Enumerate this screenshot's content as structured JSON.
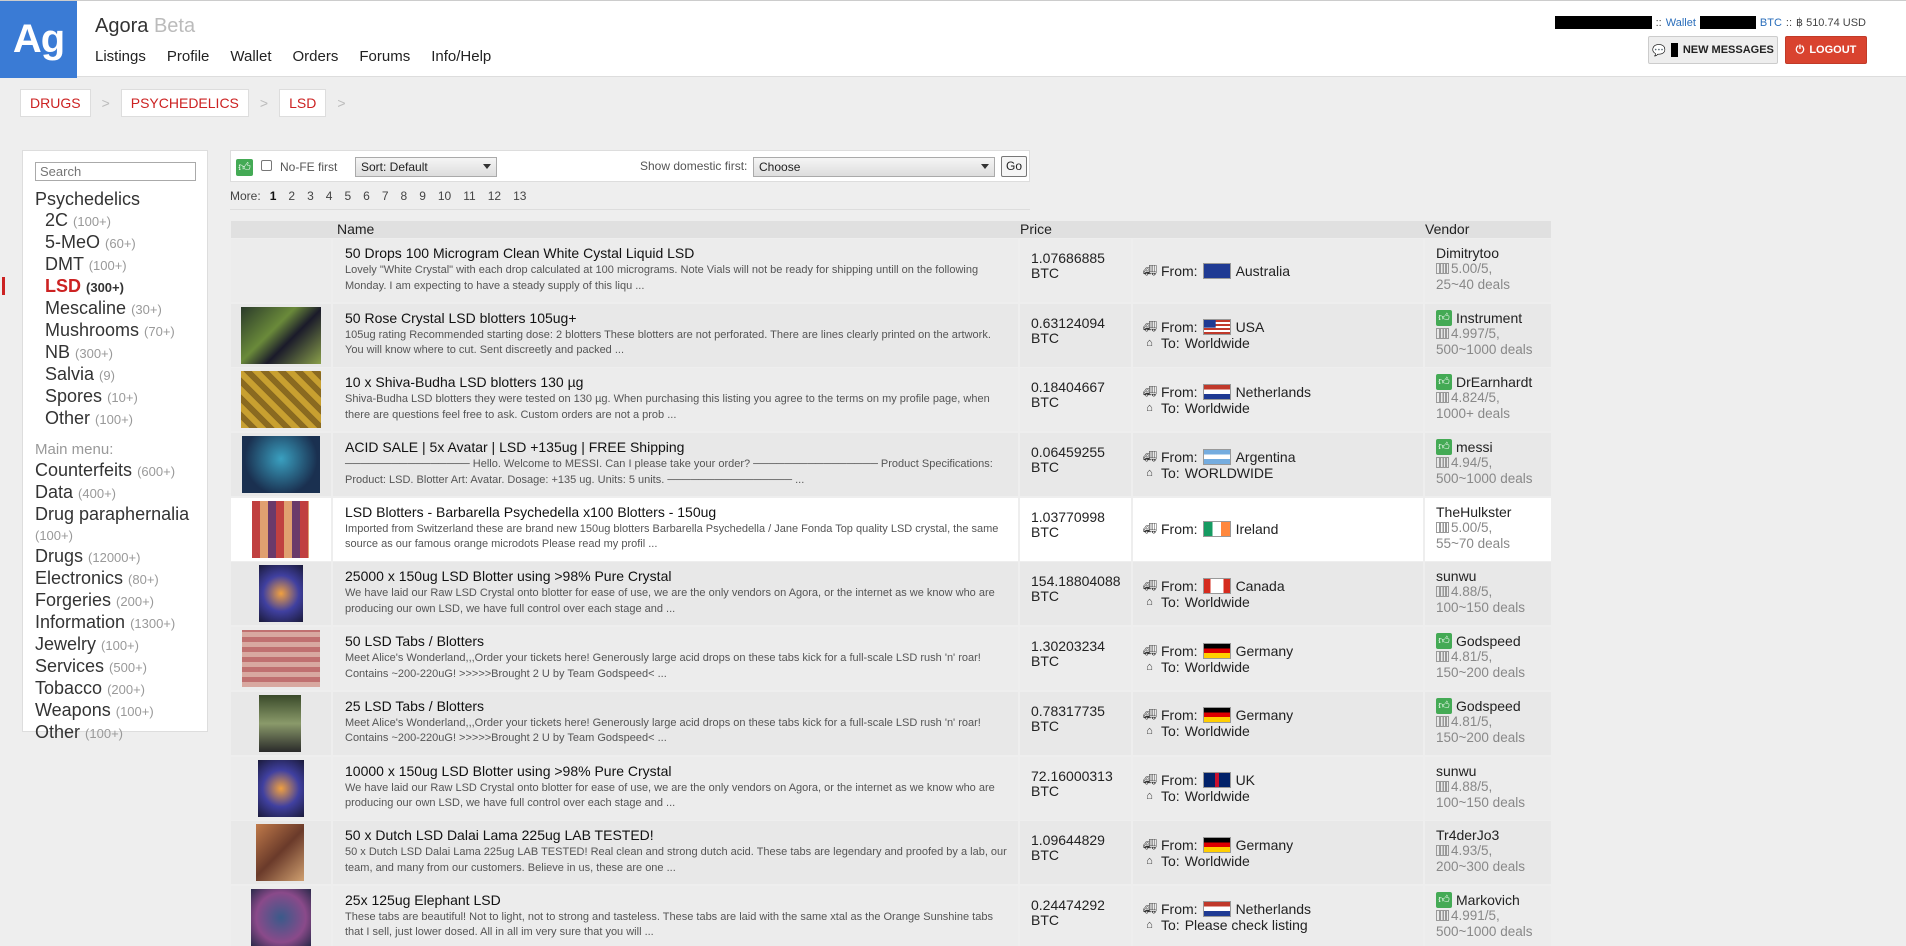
{
  "header": {
    "logo": "Ag",
    "title": "Agora",
    "beta": "Beta",
    "nav": [
      "Listings",
      "Profile",
      "Wallet",
      "Orders",
      "Forums",
      "Info/Help"
    ],
    "wallet_link": "Wallet",
    "sep1": "::",
    "sep2": "::",
    "btc_label": "BTC",
    "balance": "฿ 510.74 USD",
    "new_messages": "NEW MESSAGES",
    "logout": "LOGOUT"
  },
  "breadcrumb": [
    "DRUGS",
    "PSYCHEDELICS",
    "LSD"
  ],
  "breadcrumb_sep": ">",
  "sidebar": {
    "search_placeholder": "Search",
    "category": "Psychedelics",
    "subcategories": [
      {
        "name": "2C",
        "count": "(100+)"
      },
      {
        "name": "5-MeO",
        "count": "(60+)"
      },
      {
        "name": "DMT",
        "count": "(100+)"
      },
      {
        "name": "LSD",
        "count": "(300+)"
      },
      {
        "name": "Mescaline",
        "count": "(30+)"
      },
      {
        "name": "Mushrooms",
        "count": "(70+)"
      },
      {
        "name": "NB",
        "count": "(300+)"
      },
      {
        "name": "Salvia",
        "count": "(9)"
      },
      {
        "name": "Spores",
        "count": "(10+)"
      },
      {
        "name": "Other",
        "count": "(100+)"
      }
    ],
    "main_menu_label": "Main menu:",
    "main_menu": [
      {
        "name": "Counterfeits",
        "count": "(600+)"
      },
      {
        "name": "Data",
        "count": "(400+)"
      },
      {
        "name": "Drug paraphernalia",
        "count": "(100+)"
      },
      {
        "name": "Drugs",
        "count": "(12000+)"
      },
      {
        "name": "Electronics",
        "count": "(80+)"
      },
      {
        "name": "Forgeries",
        "count": "(200+)"
      },
      {
        "name": "Information",
        "count": "(1300+)"
      },
      {
        "name": "Jewelry",
        "count": "(100+)"
      },
      {
        "name": "Services",
        "count": "(500+)"
      },
      {
        "name": "Tobacco",
        "count": "(200+)"
      },
      {
        "name": "Weapons",
        "count": "(100+)"
      },
      {
        "name": "Other",
        "count": "(100+)"
      }
    ]
  },
  "filters": {
    "nofe": "No-FE first",
    "sort": "Sort: Default",
    "domestic_label": "Show domestic first:",
    "domestic_value": "Choose",
    "go": "Go"
  },
  "pager": {
    "label": "More:",
    "pages": [
      "1",
      "2",
      "3",
      "4",
      "5",
      "6",
      "7",
      "8",
      "9",
      "10",
      "11",
      "12",
      "13"
    ]
  },
  "table": {
    "headers": {
      "name": "Name",
      "price": "Price",
      "vendor": "Vendor"
    },
    "from_label": "From:",
    "to_label": "To:",
    "currency": "BTC",
    "listings": [
      {
        "name": "50 Drops 100 Microgram Clean White Cystal Liquid LSD",
        "desc": "Lovely \"White Crystal\" with each drop calculated at 100 micrograms. Note Vials will not be ready for shipping untill on the following Monday. I am expecting to have a steady supply of this liqu ...",
        "price": "1.07686885",
        "from": "Australia",
        "to": "",
        "vendor": "Dimitrytoo",
        "rating": "5.00/5,",
        "deals": "25~40 deals",
        "verified": false
      },
      {
        "name": "50 Rose Crystal LSD blotters 105ug+",
        "desc": "105ug rating Recommended starting dose: 2 blotters These blotters are not perforated. There are lines clearly printed on the artwork. You will know where to cut. Sent discreetly and packed ...",
        "price": "0.63124094",
        "from": "USA",
        "to": "Worldwide",
        "vendor": "Instrument",
        "rating": "4.997/5,",
        "deals": "500~1000 deals",
        "verified": true
      },
      {
        "name": "10 x Shiva-Budha LSD blotters 130 µg",
        "desc": "Shiva-Budha LSD blotters they were tested on 130 µg. When purchasing this listing you agree to the terms on my profile page, when there are questions feel free to ask. Custom orders are not a prob ...",
        "price": "0.18404667",
        "from": "Netherlands",
        "to": "Worldwide",
        "vendor": "DrEarnhardt",
        "rating": "4.824/5,",
        "deals": "1000+ deals",
        "verified": true
      },
      {
        "name": "ACID SALE | 5x Avatar | LSD +135ug | FREE Shipping",
        "desc": "──────────────── Hello. Welcome to MESSI. Can I please take your order? ──────────────── Product Specifications: Product: LSD. Blotter Art: Avatar. Dosage: +135 ug. Units: 5 units. ──────────────── ...",
        "price": "0.06459255",
        "from": "Argentina",
        "to": "WORLDWIDE",
        "vendor": "messi",
        "rating": "4.94/5,",
        "deals": "500~1000 deals",
        "verified": true
      },
      {
        "name": "LSD Blotters - Barbarella Psychedella x100 Blotters - 150ug",
        "desc": "Imported from Switzerland these are brand new 150ug blotters Barbarella Psychedella / Jane Fonda Top quality LSD crystal, the same source as our famous orange microdots Please read my profil ...",
        "price": "1.03770998",
        "from": "Ireland",
        "to": "",
        "vendor": "TheHulkster",
        "rating": "5.00/5,",
        "deals": "55~70 deals",
        "verified": false
      },
      {
        "name": "25000 x 150ug LSD Blotter using >98% Pure Crystal",
        "desc": "We have laid our Raw LSD Crystal onto blotter for ease of use, we are the only vendors on Agora, or the internet as we know who are producing our own LSD, we have full control over each stage and ...",
        "price": "154.18804088",
        "from": "Canada",
        "to": "Worldwide",
        "vendor": "sunwu",
        "rating": "4.88/5,",
        "deals": "100~150 deals",
        "verified": false
      },
      {
        "name": "50 LSD Tabs / Blotters",
        "desc": "Meet Alice's Wonderland,,,Order your tickets here! Generously large acid drops on these tabs kick for a full-scale LSD rush 'n' roar! Contains ~200-220uG! >>>>>Brought 2 U by Team Godspeed< ...",
        "price": "1.30203234",
        "from": "Germany",
        "to": "Worldwide",
        "vendor": "Godspeed",
        "rating": "4.81/5,",
        "deals": "150~200 deals",
        "verified": true
      },
      {
        "name": "25 LSD Tabs / Blotters",
        "desc": "Meet Alice's Wonderland,,,Order your tickets here! Generously large acid drops on these tabs kick for a full-scale LSD rush 'n' roar! Contains ~200-220uG! >>>>>Brought 2 U by Team Godspeed< ...",
        "price": "0.78317735",
        "from": "Germany",
        "to": "Worldwide",
        "vendor": "Godspeed",
        "rating": "4.81/5,",
        "deals": "150~200 deals",
        "verified": true
      },
      {
        "name": "10000 x 150ug LSD Blotter using >98% Pure Crystal",
        "desc": "We have laid our Raw LSD Crystal onto blotter for ease of use, we are the only vendors on Agora, or the internet as we know who are producing our own LSD, we have full control over each stage and ...",
        "price": "72.16000313",
        "from": "UK",
        "to": "Worldwide",
        "vendor": "sunwu",
        "rating": "4.88/5,",
        "deals": "100~150 deals",
        "verified": false
      },
      {
        "name": "50 x Dutch LSD Dalai Lama 225ug LAB TESTED!",
        "desc": "50 x Dutch LSD Dalai Lama 225ug LAB TESTED! Real clean and strong dutch acid. These tabs are legendary and proofed by a lab, our team, and many from our customers. Believe in us, these are one ...",
        "price": "1.09644829",
        "from": "Germany",
        "to": "Worldwide",
        "vendor": "Tr4derJo3",
        "rating": "4.93/5,",
        "deals": "200~300 deals",
        "verified": false
      },
      {
        "name": "25x 125ug Elephant LSD",
        "desc": "These tabs are beautiful! Not to light, not to strong and tasteless. These tabs are laid with the same xtal as the Orange Sunshine tabs that I sell, just lower dosed. All in all im very sure that you will ...",
        "price": "0.24474292",
        "from": "Netherlands",
        "to": "Please check listing",
        "vendor": "Markovich",
        "rating": "4.991/5,",
        "deals": "500~1000 deals",
        "verified": true
      }
    ]
  },
  "colors": {
    "logo_bg": "#3a7bd5",
    "accent_red": "#cc2222",
    "logout_red": "#d9432f",
    "verified_green": "#44aa55"
  }
}
